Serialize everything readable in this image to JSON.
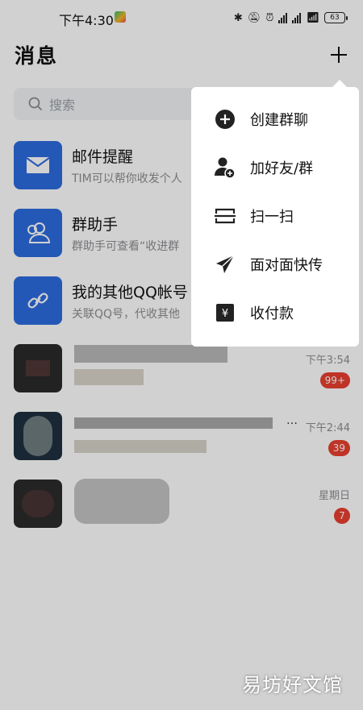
{
  "status": {
    "time": "下午4:30",
    "battery": "63",
    "sig_label": "HD"
  },
  "header": {
    "title": "消息"
  },
  "search": {
    "placeholder": "搜索"
  },
  "conversations": [
    {
      "name": "邮件提醒",
      "preview": "TIM可以帮你收发个人",
      "time": "",
      "badge": ""
    },
    {
      "name": "群助手",
      "preview": "群助手可查看“收进群",
      "time": "",
      "badge": ""
    },
    {
      "name": "我的其他QQ帐号",
      "preview": "关联QQ号，代收其他",
      "time": "",
      "badge": ""
    },
    {
      "name": "",
      "preview": "",
      "time": "下午3:54",
      "badge": "99+"
    },
    {
      "name": "",
      "preview": "",
      "time": "下午2:44",
      "badge": "39",
      "suffix": "…"
    },
    {
      "name": "",
      "preview": "",
      "time": "星期日",
      "badge": "7"
    }
  ],
  "menu": [
    {
      "label": "创建群聊",
      "icon": "add-circle-icon"
    },
    {
      "label": "加好友/群",
      "icon": "add-friend-icon"
    },
    {
      "label": "扫一扫",
      "icon": "scan-icon"
    },
    {
      "label": "面对面快传",
      "icon": "paper-plane-icon"
    },
    {
      "label": "收付款",
      "icon": "yuan-icon"
    }
  ],
  "watermark": "易坊好文馆",
  "colors": {
    "accent": "#2d6cdf",
    "badge": "#e9402f"
  }
}
